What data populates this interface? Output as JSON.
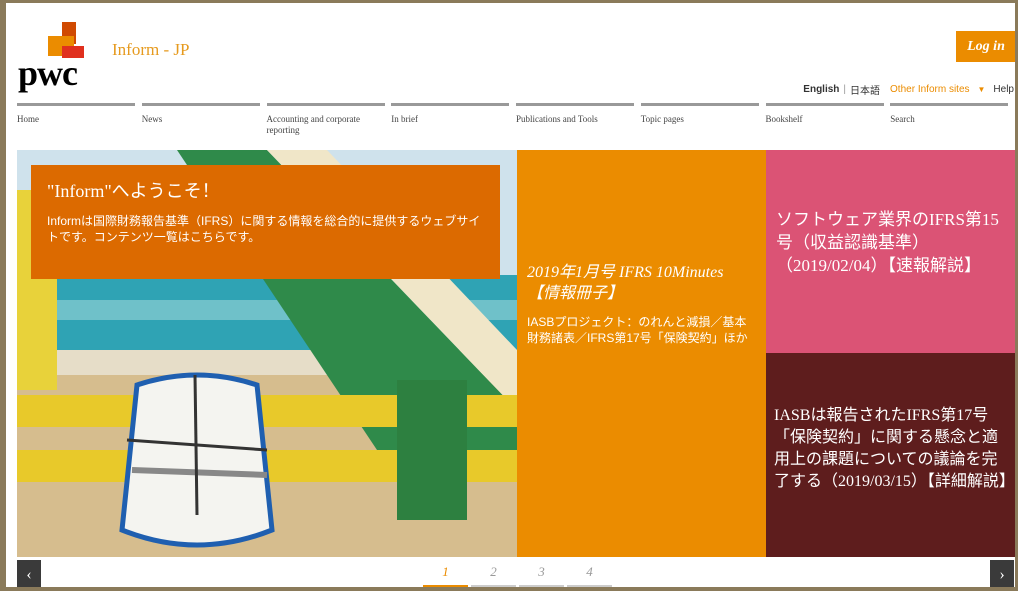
{
  "header": {
    "app_title": "Inform - JP",
    "logo_text": "pwc",
    "login_label": "Log in",
    "lang": {
      "english": "English",
      "japanese": "日本語",
      "other_sites": "Other Inform sites",
      "help": "Help"
    }
  },
  "nav": {
    "items": [
      {
        "label": "Home"
      },
      {
        "label": "News"
      },
      {
        "label": "Accounting and corporate reporting"
      },
      {
        "label": "In brief"
      },
      {
        "label": "Publications and Tools"
      },
      {
        "label": "Topic pages"
      },
      {
        "label": "Bookshelf"
      },
      {
        "label": "Search"
      }
    ]
  },
  "hero": {
    "title": "\"Inform\"へようこそ！",
    "body": "Informは国際財務報告基準（IFRS）に関する情報を総合的に提供するウェブサイトです。コンテンツ一覧はこちらです。"
  },
  "tiles": {
    "orange": {
      "title": "2019年1月号 IFRS 10Minutes 【情報冊子】",
      "body": "IASBプロジェクト：のれんと減損／基本財務諸表／IFRS第17号「保険契約」ほか"
    },
    "pink": {
      "title": "ソフトウェア業界のIFRS第15号（収益認識基準）（2019/02/04）【速報解説】"
    },
    "maroon": {
      "title": "IASBは報告されたIFRS第17号「保険契約」に関する懸念と適用上の課題についての議論を完了する（2019/03/15）【詳細解説】"
    }
  },
  "carousel": {
    "prev": "‹",
    "next": "›",
    "pages": [
      "1",
      "2",
      "3",
      "4"
    ],
    "active_page": 1
  },
  "colors": {
    "accent": "#eb8c00",
    "hero_card": "#dc6a00",
    "pink": "#db5375",
    "maroon": "#5e1d1d"
  }
}
